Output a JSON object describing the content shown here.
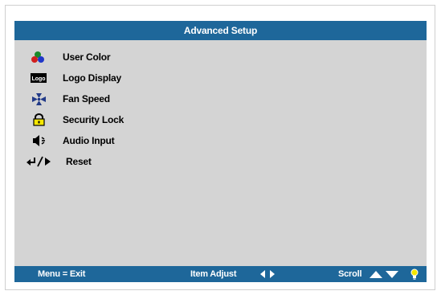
{
  "window": {
    "title": "Advanced Setup"
  },
  "menu": {
    "items": [
      {
        "label": "User Color",
        "icon": "user-color-icon"
      },
      {
        "label": "Logo Display",
        "icon": "logo-icon",
        "icon_text": "Logo"
      },
      {
        "label": "Fan Speed",
        "icon": "fan-icon"
      },
      {
        "label": "Security Lock",
        "icon": "lock-icon"
      },
      {
        "label": "Audio Input",
        "icon": "speaker-icon"
      },
      {
        "label": "Reset",
        "icon": "reset-icon"
      }
    ]
  },
  "footer": {
    "exit_label": "Menu = Exit",
    "adjust_label": "Item Adjust",
    "scroll_label": "Scroll"
  },
  "colors": {
    "bar": "#1e679a",
    "panel": "#d4d4d4",
    "text": "#000000",
    "bar_text": "#ffffff",
    "lock": "#f5e600"
  }
}
